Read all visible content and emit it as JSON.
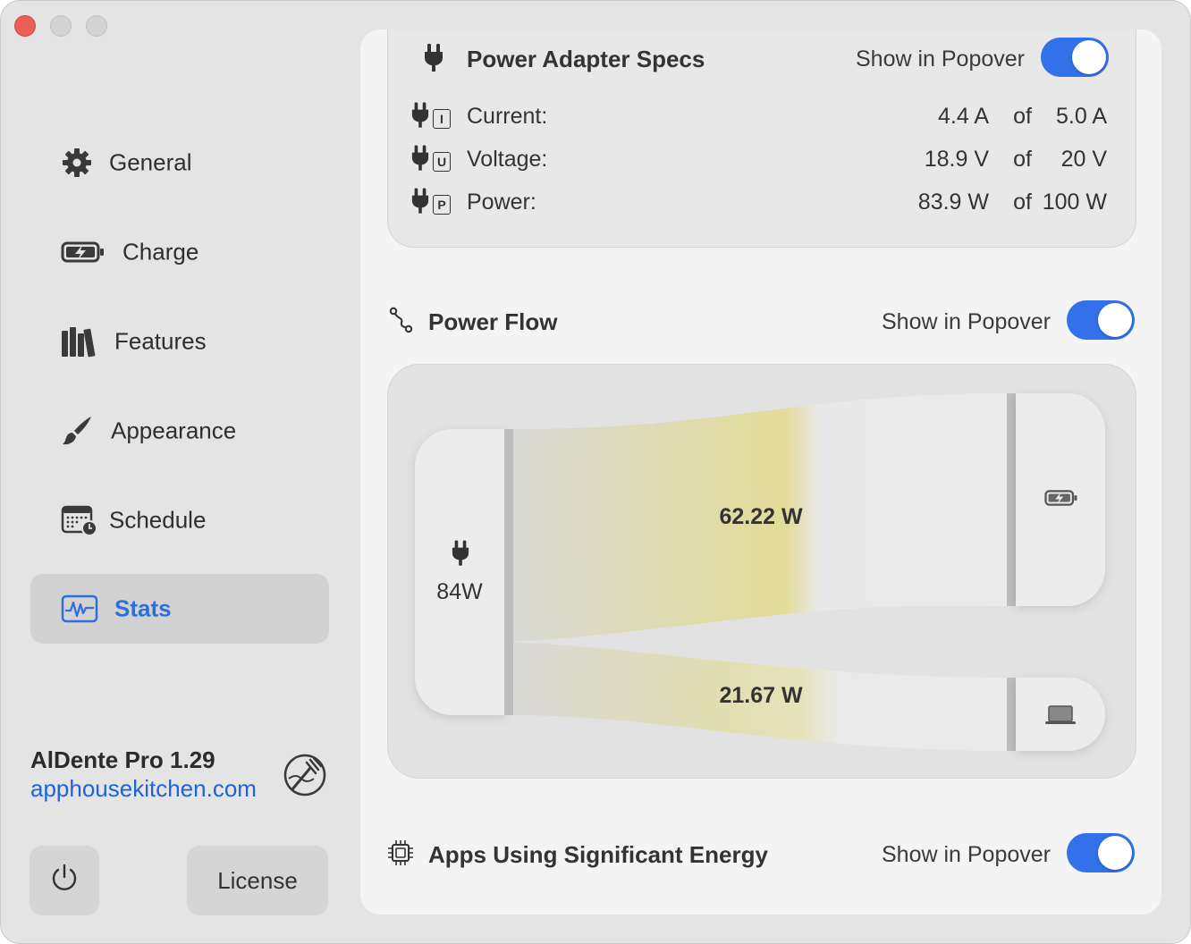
{
  "sidebar": {
    "items": [
      {
        "label": "General",
        "icon": "gear-icon"
      },
      {
        "label": "Charge",
        "icon": "battery-charging-icon"
      },
      {
        "label": "Features",
        "icon": "books-icon"
      },
      {
        "label": "Appearance",
        "icon": "paintbrush-icon"
      },
      {
        "label": "Schedule",
        "icon": "calendar-clock-icon"
      },
      {
        "label": "Stats",
        "icon": "waveform-chart-icon",
        "active": true
      }
    ],
    "app_name": "AlDente Pro 1.29",
    "app_link": "apphousekitchen.com",
    "license_label": "License"
  },
  "adapter": {
    "title": "Power Adapter Specs",
    "popover_label": "Show in Popover",
    "popover_on": true,
    "rows": [
      {
        "letter": "I",
        "label": "Current:",
        "value": "4.4 A",
        "of": "of",
        "max": "5.0 A"
      },
      {
        "letter": "U",
        "label": "Voltage:",
        "value": "18.9 V",
        "of": "of",
        "max": "20 V"
      },
      {
        "letter": "P",
        "label": "Power:",
        "value": "83.9 W",
        "of": "of",
        "max": "100 W"
      }
    ]
  },
  "power_flow": {
    "title": "Power Flow",
    "popover_label": "Show in Popover",
    "popover_on": true,
    "source_label": "84W",
    "battery_flow": "62.22 W",
    "system_flow": "21.67 W"
  },
  "apps_energy": {
    "title": "Apps Using Significant Energy",
    "popover_label": "Show in Popover",
    "popover_on": true
  },
  "colors": {
    "accent": "#3271ea",
    "link": "#1f63d6",
    "flow_yellow": "#e3dd9a"
  }
}
